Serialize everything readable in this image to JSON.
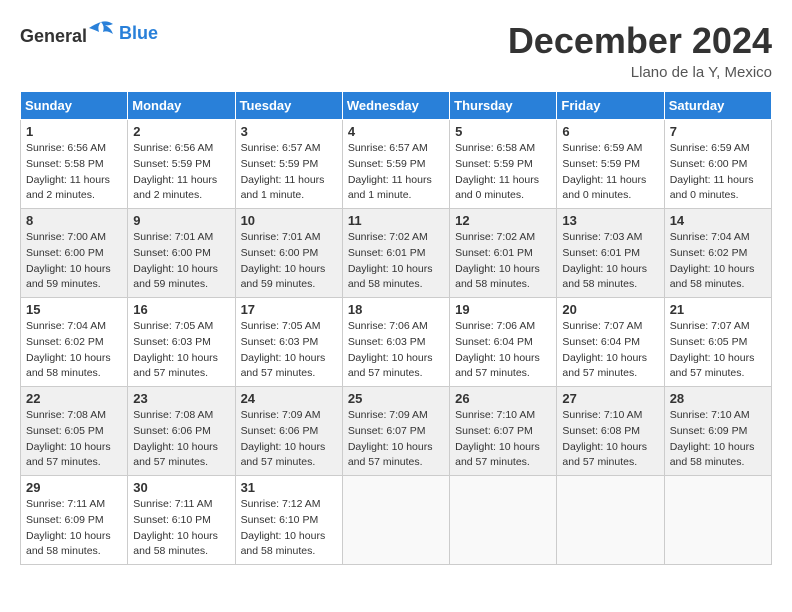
{
  "header": {
    "logo_general": "General",
    "logo_blue": "Blue",
    "month_title": "December 2024",
    "location": "Llano de la Y, Mexico"
  },
  "weekdays": [
    "Sunday",
    "Monday",
    "Tuesday",
    "Wednesday",
    "Thursday",
    "Friday",
    "Saturday"
  ],
  "weeks": [
    [
      {
        "day": "1",
        "info": "Sunrise: 6:56 AM\nSunset: 5:58 PM\nDaylight: 11 hours and 2 minutes."
      },
      {
        "day": "2",
        "info": "Sunrise: 6:56 AM\nSunset: 5:59 PM\nDaylight: 11 hours and 2 minutes."
      },
      {
        "day": "3",
        "info": "Sunrise: 6:57 AM\nSunset: 5:59 PM\nDaylight: 11 hours and 1 minute."
      },
      {
        "day": "4",
        "info": "Sunrise: 6:57 AM\nSunset: 5:59 PM\nDaylight: 11 hours and 1 minute."
      },
      {
        "day": "5",
        "info": "Sunrise: 6:58 AM\nSunset: 5:59 PM\nDaylight: 11 hours and 0 minutes."
      },
      {
        "day": "6",
        "info": "Sunrise: 6:59 AM\nSunset: 5:59 PM\nDaylight: 11 hours and 0 minutes."
      },
      {
        "day": "7",
        "info": "Sunrise: 6:59 AM\nSunset: 6:00 PM\nDaylight: 11 hours and 0 minutes."
      }
    ],
    [
      {
        "day": "8",
        "info": "Sunrise: 7:00 AM\nSunset: 6:00 PM\nDaylight: 10 hours and 59 minutes."
      },
      {
        "day": "9",
        "info": "Sunrise: 7:01 AM\nSunset: 6:00 PM\nDaylight: 10 hours and 59 minutes."
      },
      {
        "day": "10",
        "info": "Sunrise: 7:01 AM\nSunset: 6:00 PM\nDaylight: 10 hours and 59 minutes."
      },
      {
        "day": "11",
        "info": "Sunrise: 7:02 AM\nSunset: 6:01 PM\nDaylight: 10 hours and 58 minutes."
      },
      {
        "day": "12",
        "info": "Sunrise: 7:02 AM\nSunset: 6:01 PM\nDaylight: 10 hours and 58 minutes."
      },
      {
        "day": "13",
        "info": "Sunrise: 7:03 AM\nSunset: 6:01 PM\nDaylight: 10 hours and 58 minutes."
      },
      {
        "day": "14",
        "info": "Sunrise: 7:04 AM\nSunset: 6:02 PM\nDaylight: 10 hours and 58 minutes."
      }
    ],
    [
      {
        "day": "15",
        "info": "Sunrise: 7:04 AM\nSunset: 6:02 PM\nDaylight: 10 hours and 58 minutes."
      },
      {
        "day": "16",
        "info": "Sunrise: 7:05 AM\nSunset: 6:03 PM\nDaylight: 10 hours and 57 minutes."
      },
      {
        "day": "17",
        "info": "Sunrise: 7:05 AM\nSunset: 6:03 PM\nDaylight: 10 hours and 57 minutes."
      },
      {
        "day": "18",
        "info": "Sunrise: 7:06 AM\nSunset: 6:03 PM\nDaylight: 10 hours and 57 minutes."
      },
      {
        "day": "19",
        "info": "Sunrise: 7:06 AM\nSunset: 6:04 PM\nDaylight: 10 hours and 57 minutes."
      },
      {
        "day": "20",
        "info": "Sunrise: 7:07 AM\nSunset: 6:04 PM\nDaylight: 10 hours and 57 minutes."
      },
      {
        "day": "21",
        "info": "Sunrise: 7:07 AM\nSunset: 6:05 PM\nDaylight: 10 hours and 57 minutes."
      }
    ],
    [
      {
        "day": "22",
        "info": "Sunrise: 7:08 AM\nSunset: 6:05 PM\nDaylight: 10 hours and 57 minutes."
      },
      {
        "day": "23",
        "info": "Sunrise: 7:08 AM\nSunset: 6:06 PM\nDaylight: 10 hours and 57 minutes."
      },
      {
        "day": "24",
        "info": "Sunrise: 7:09 AM\nSunset: 6:06 PM\nDaylight: 10 hours and 57 minutes."
      },
      {
        "day": "25",
        "info": "Sunrise: 7:09 AM\nSunset: 6:07 PM\nDaylight: 10 hours and 57 minutes."
      },
      {
        "day": "26",
        "info": "Sunrise: 7:10 AM\nSunset: 6:07 PM\nDaylight: 10 hours and 57 minutes."
      },
      {
        "day": "27",
        "info": "Sunrise: 7:10 AM\nSunset: 6:08 PM\nDaylight: 10 hours and 57 minutes."
      },
      {
        "day": "28",
        "info": "Sunrise: 7:10 AM\nSunset: 6:09 PM\nDaylight: 10 hours and 58 minutes."
      }
    ],
    [
      {
        "day": "29",
        "info": "Sunrise: 7:11 AM\nSunset: 6:09 PM\nDaylight: 10 hours and 58 minutes."
      },
      {
        "day": "30",
        "info": "Sunrise: 7:11 AM\nSunset: 6:10 PM\nDaylight: 10 hours and 58 minutes."
      },
      {
        "day": "31",
        "info": "Sunrise: 7:12 AM\nSunset: 6:10 PM\nDaylight: 10 hours and 58 minutes."
      },
      {
        "day": "",
        "info": ""
      },
      {
        "day": "",
        "info": ""
      },
      {
        "day": "",
        "info": ""
      },
      {
        "day": "",
        "info": ""
      }
    ]
  ]
}
